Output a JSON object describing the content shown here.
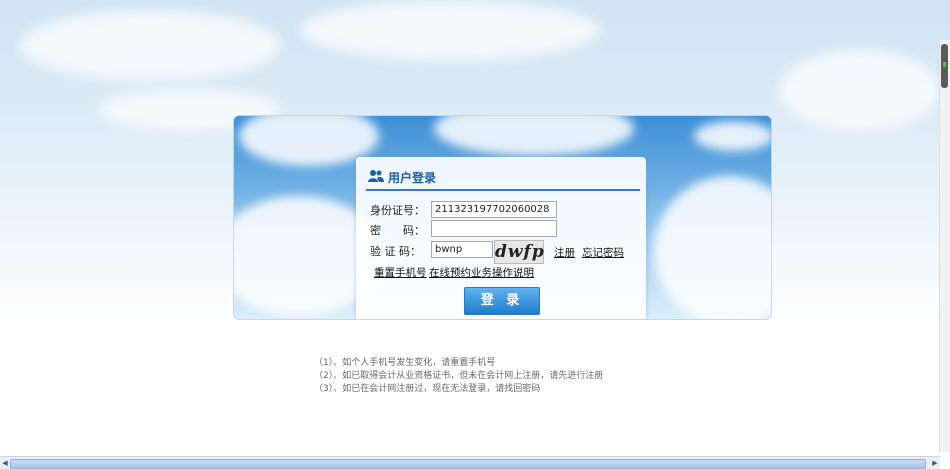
{
  "login": {
    "title": "用户登录",
    "id_label": "身份证号：",
    "id_value": "211323197702060028",
    "password_label": "密　　码：",
    "password_value": "",
    "captcha_label": "验 证 码：",
    "captcha_value": "bwnp",
    "captcha_image_text": "dwfp",
    "register_link": "注册",
    "forgot_link": "忘记密码",
    "reset_phone_link": "重置手机号",
    "guide_link": "在线预约业务操作说明",
    "submit_label": "登 录"
  },
  "notes": [
    "（1）、如个人手机号发生变化，请重置手机号",
    "（2）、如已取得会计从业资格证书，但未在会计网上注册，请先进行注册",
    "（3）、如已在会计网注册过，现在无法登录，请找回密码"
  ],
  "colors": {
    "accent": "#1f7ccc",
    "title": "#1d5fa6"
  },
  "icons": {
    "header": "users-icon"
  }
}
